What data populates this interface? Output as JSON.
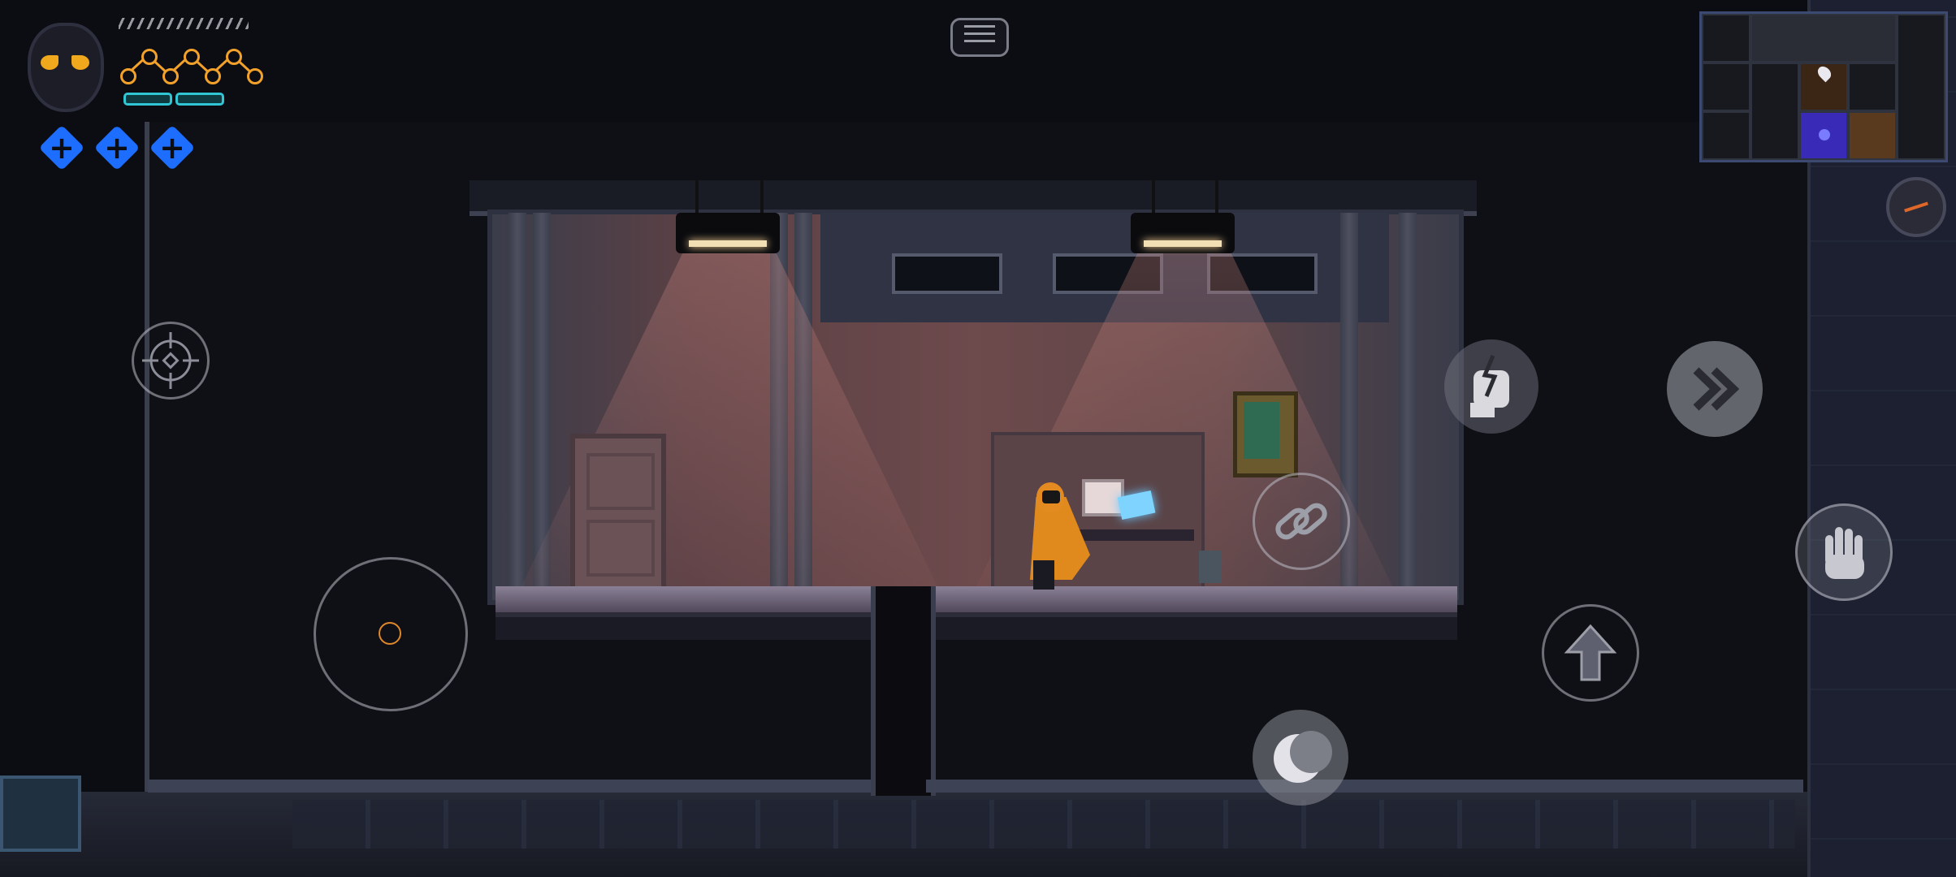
{
  "hud": {
    "portrait_icon": "masked-hero-portrait",
    "health_nodes": 7,
    "mana_bars": 2,
    "healing_flasks": 3,
    "stamina_icon": "stamina-slash-bar"
  },
  "menu": {
    "icon": "menu-icon"
  },
  "minimap": {
    "current_room_color": "#3a2ab8",
    "adjacent_room_color": "#5a3a1e",
    "marker_icon": "map-pin-icon"
  },
  "controls": {
    "joystick_icon": "virtual-joystick",
    "target_icon": "crosshair-target-icon",
    "skill_icon": "fist-lightning-icon",
    "dash_icon": "double-chevron-right-icon",
    "grab_icon": "hand-icon",
    "chain_icon": "chain-link-icon",
    "jump_icon": "arrow-up-icon",
    "crescent_icon": "crescent-moon-icon",
    "compass_icon": "compass-icon"
  },
  "colors": {
    "accent_orange": "#f2a12a",
    "mana_cyan": "#31c6d4",
    "flask_blue": "#1d6eff",
    "room_light": "#6d4a4c"
  }
}
